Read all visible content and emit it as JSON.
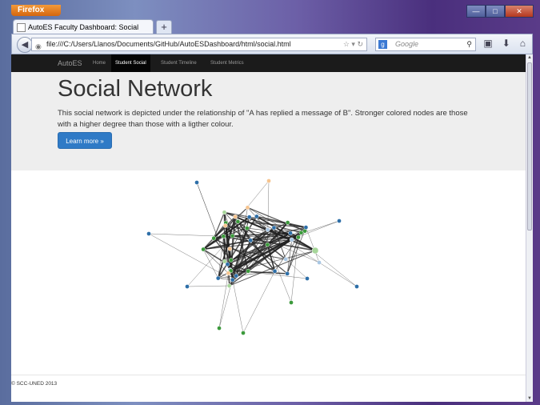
{
  "browser": {
    "app_button": "Firefox",
    "tab_title": "AutoES Faculty Dashboard: Social",
    "new_tab": "+",
    "url": "file:///C:/Users/Llanos/Documents/GitHub/AutoESDashboard/html/social.html",
    "search_placeholder": "Google"
  },
  "site": {
    "brand": "AutoES",
    "nav": [
      {
        "label": "Home",
        "active": false
      },
      {
        "label": "Student Social",
        "active": true
      },
      {
        "label": "Student Timeline",
        "active": false
      },
      {
        "label": "Student Metrics",
        "active": false
      }
    ]
  },
  "hero": {
    "title": "Social Network",
    "description": "This social network is depicted under the relationship of \"A has replied a message of B\". Stronger colored nodes are those with a higher degree than those with a ligther colour.",
    "button": "Learn more »"
  },
  "footer": {
    "text": "© SCC-UNED 2013"
  },
  "colors": {
    "node_blue": "#2e6fa8",
    "node_light_blue": "#a9c7e3",
    "node_orange": "#f08a24",
    "node_light_orange": "#f6c48f",
    "node_green": "#3c9a3c",
    "node_light_green": "#a7d69a",
    "link": "#222222"
  }
}
